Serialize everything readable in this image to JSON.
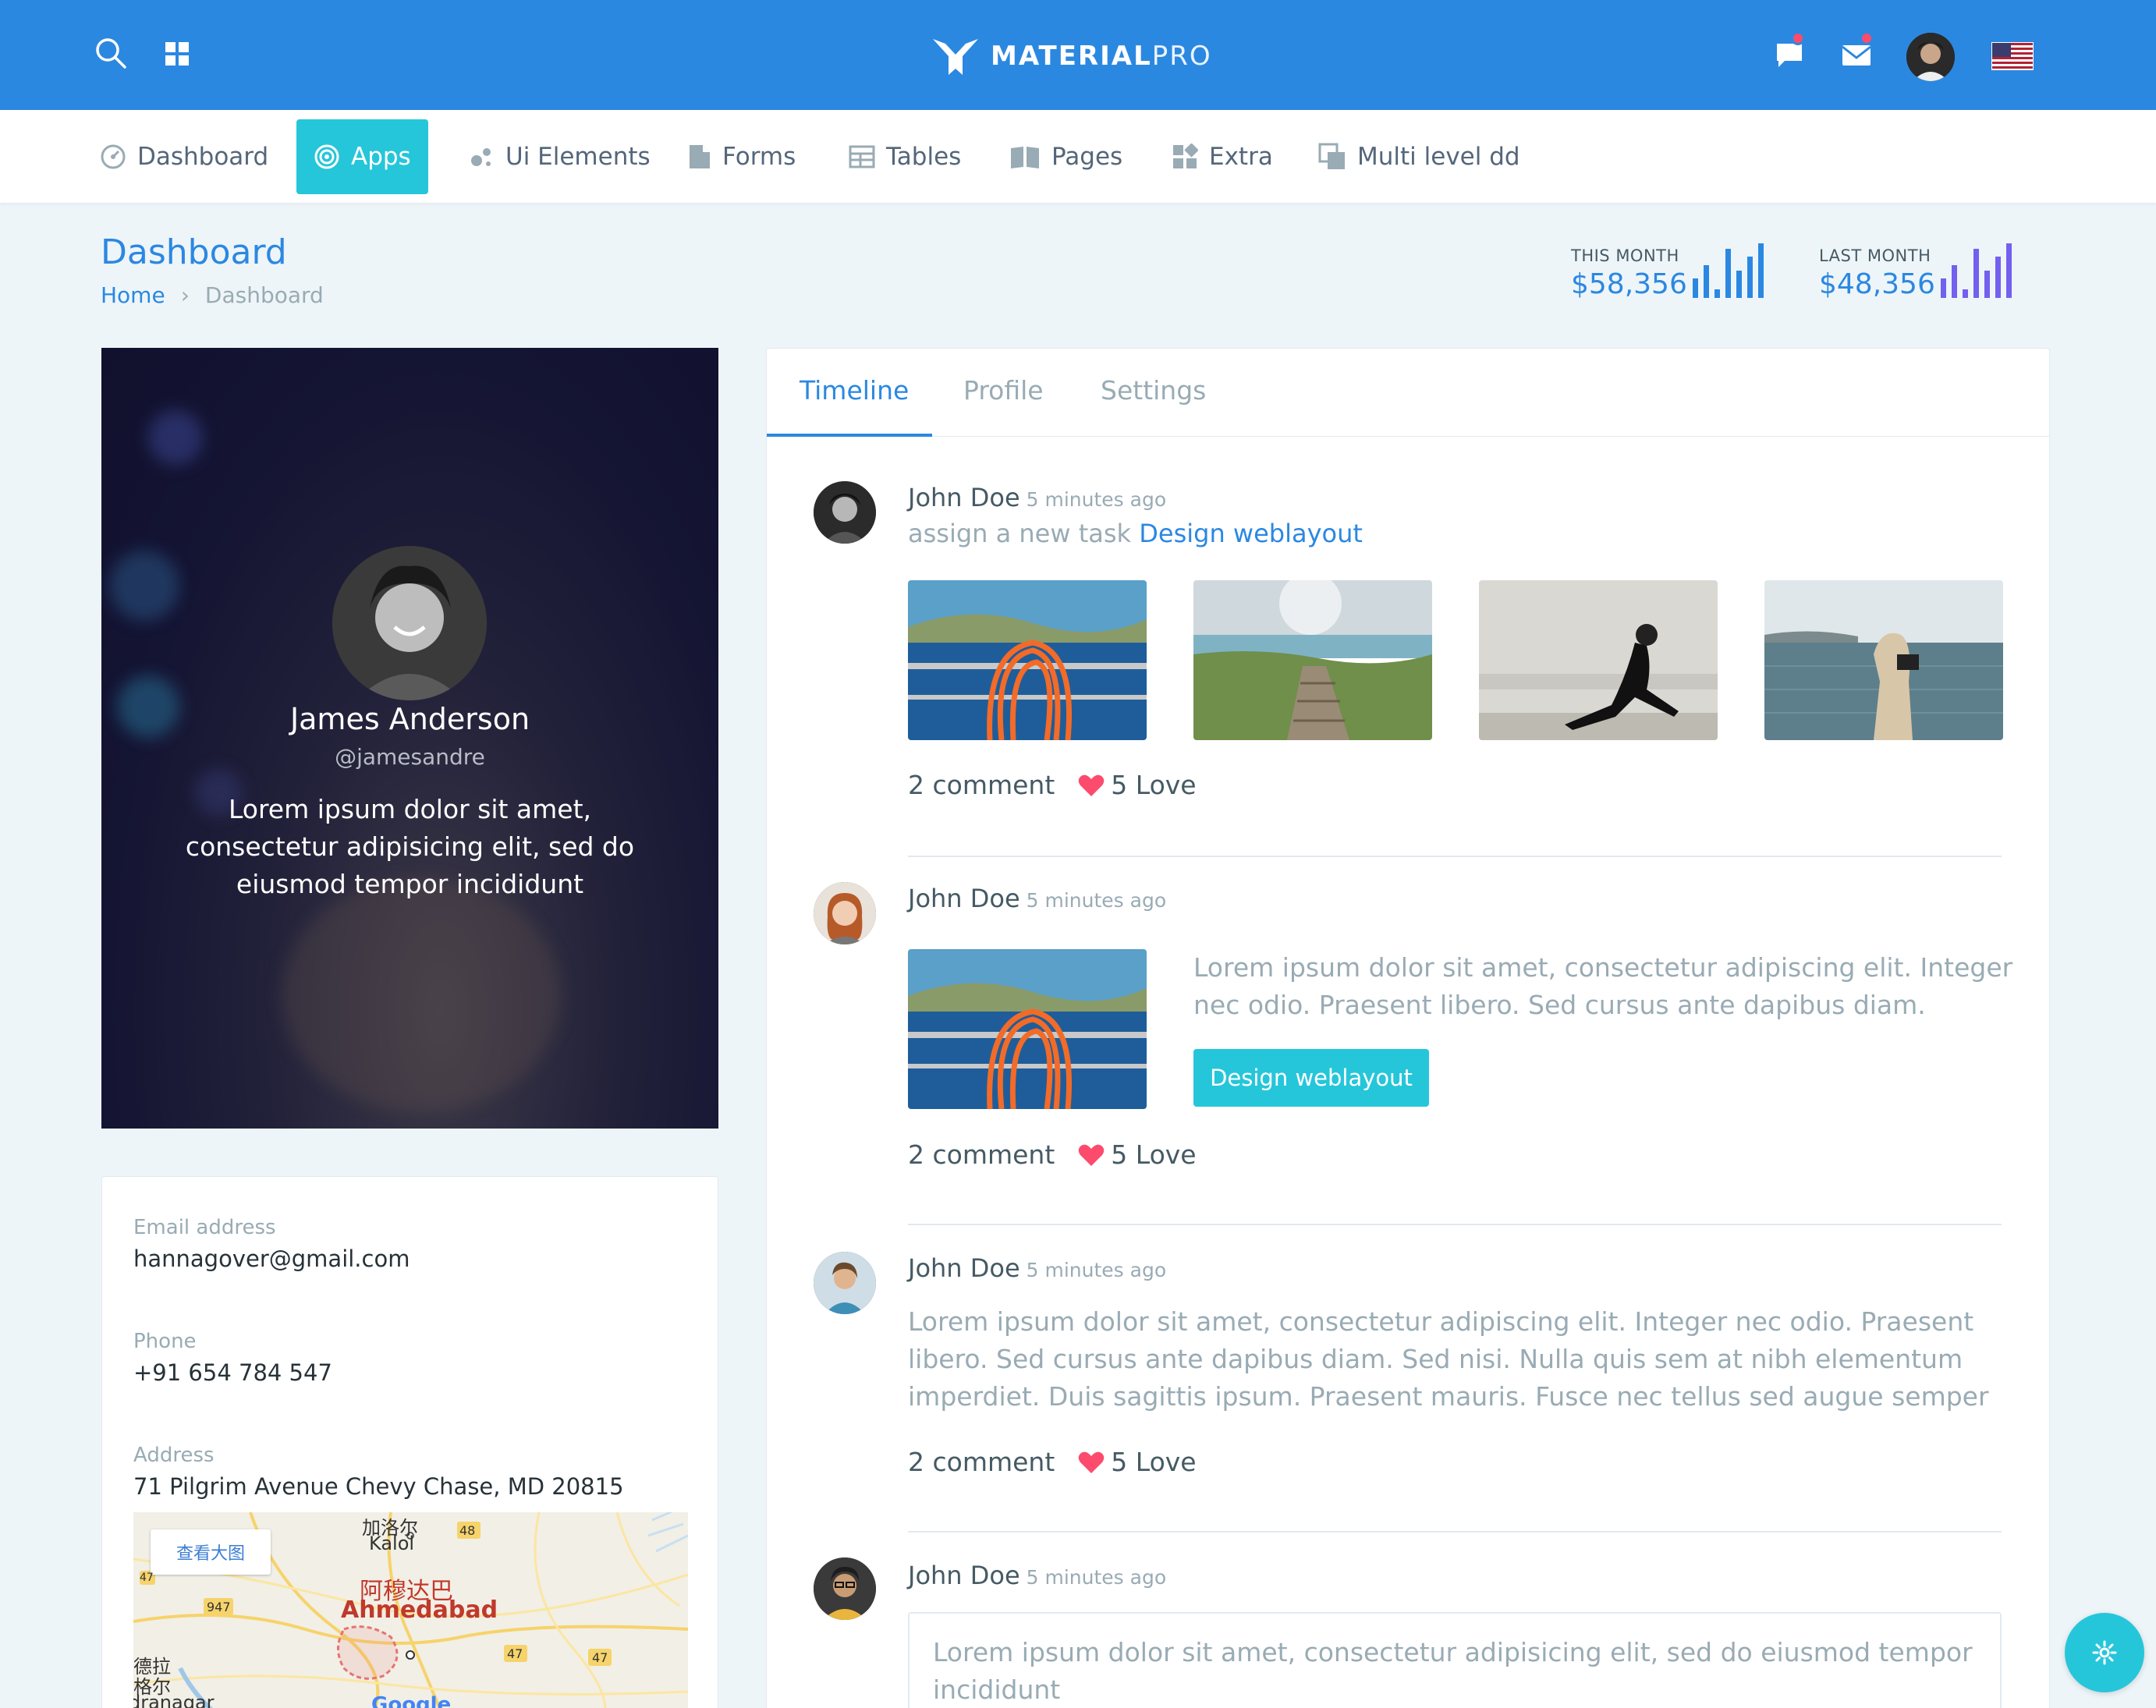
{
  "brand": {
    "name_bold": "MATERIAL",
    "name_light": "PRO"
  },
  "colors": {
    "primary": "#2b88e1",
    "accent": "#26c6da",
    "danger": "#fc4b6c",
    "purple": "#7460ee"
  },
  "nav": [
    {
      "label": "Dashboard",
      "icon": "dashboard-icon"
    },
    {
      "label": "Apps",
      "icon": "target-icon",
      "active": true
    },
    {
      "label": "Ui Elements",
      "icon": "bubbles-icon"
    },
    {
      "label": "Forms",
      "icon": "file-icon"
    },
    {
      "label": "Tables",
      "icon": "table-icon"
    },
    {
      "label": "Pages",
      "icon": "book-icon"
    },
    {
      "label": "Extra",
      "icon": "widgets-icon"
    },
    {
      "label": "Multi level dd",
      "icon": "layers-icon"
    }
  ],
  "page": {
    "title": "Dashboard",
    "breadcrumb": {
      "home": "Home",
      "current": "Dashboard"
    }
  },
  "stats": [
    {
      "label": "THIS MONTH",
      "value": "$58,356",
      "color": "#2b88e1",
      "bars": [
        0.35,
        0.6,
        0.15,
        0.9,
        0.5,
        0.75,
        1.0
      ]
    },
    {
      "label": "LAST MONTH",
      "value": "$48,356",
      "color": "#7460ee",
      "bars": [
        0.35,
        0.6,
        0.15,
        0.9,
        0.5,
        0.75,
        1.0
      ]
    }
  ],
  "profile": {
    "name": "James Anderson",
    "handle": "@jamesandre",
    "bio": "Lorem ipsum dolor sit amet, consectetur adipisicing elit, sed do eiusmod tempor incididunt"
  },
  "contact": {
    "email_label": "Email address",
    "email": "hannagover@gmail.com",
    "phone_label": "Phone",
    "phone": "+91 654 784 547",
    "address_label": "Address",
    "address": "71 Pilgrim Avenue Chevy Chase, MD 20815",
    "map": {
      "view_larger": "查看大图",
      "city_cn": "阿穆达巴",
      "city": "Ahmedabad",
      "town_cn": "加洛尔",
      "town": "Kalol",
      "west_cn_1": "德拉",
      "west_cn_2": "格尔",
      "west_partial": "dranagar",
      "routes": [
        "48",
        "947",
        "47",
        "47",
        "47"
      ],
      "provider": "Google"
    }
  },
  "tabs": [
    "Timeline",
    "Profile",
    "Settings"
  ],
  "timeline": {
    "author": "John Doe",
    "time": "5 minutes ago",
    "comments": "2 comment",
    "loves": "5 Love",
    "post1_action": "assign a new task",
    "post1_link": "Design weblayout",
    "post2_text": "Lorem ipsum dolor sit amet, consectetur adipiscing elit. Integer nec odio. Praesent libero. Sed cursus ante dapibus diam.",
    "post2_button": "Design weblayout",
    "post3_text": "Lorem ipsum dolor sit amet, consectetur adipiscing elit. Integer nec odio. Praesent libero. Sed cursus ante dapibus diam. Sed nisi. Nulla quis sem at nibh elementum imperdiet. Duis sagittis ipsum. Praesent mauris. Fusce nec tellus sed augue semper",
    "post4_quote": "Lorem ipsum dolor sit amet, consectetur adipisicing elit, sed do eiusmod tempor incididunt"
  }
}
